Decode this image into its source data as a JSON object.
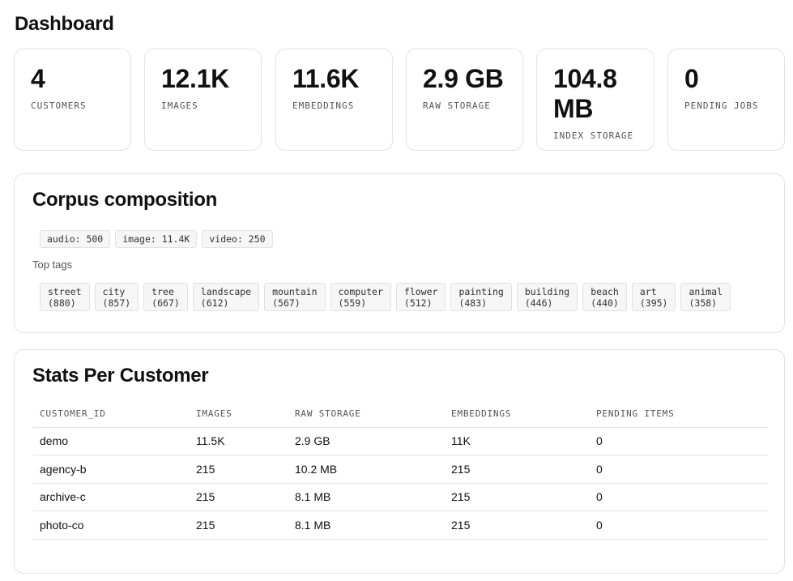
{
  "header": {
    "title": "Dashboard"
  },
  "stats": [
    {
      "value": "4",
      "label": "CUSTOMERS"
    },
    {
      "value": "12.1K",
      "label": "IMAGES"
    },
    {
      "value": "11.6K",
      "label": "EMBEDDINGS"
    },
    {
      "value": "2.9 GB",
      "label": "RAW STORAGE"
    },
    {
      "value": "104.8 MB",
      "label": "INDEX STORAGE"
    },
    {
      "value": "0",
      "label": "PENDING JOBS"
    }
  ],
  "corpus": {
    "title": "Corpus composition",
    "kinds": [
      "audio: 500",
      "image: 11.4K",
      "video: 250"
    ],
    "top_tags_label": "Top tags",
    "tags": [
      {
        "name": "street",
        "count": "(880)"
      },
      {
        "name": "city",
        "count": "(857)"
      },
      {
        "name": "tree",
        "count": "(667)"
      },
      {
        "name": "landscape",
        "count": "(612)"
      },
      {
        "name": "mountain",
        "count": "(567)"
      },
      {
        "name": "computer",
        "count": "(559)"
      },
      {
        "name": "flower",
        "count": "(512)"
      },
      {
        "name": "painting",
        "count": "(483)"
      },
      {
        "name": "building",
        "count": "(446)"
      },
      {
        "name": "beach",
        "count": "(440)"
      },
      {
        "name": "art",
        "count": "(395)"
      },
      {
        "name": "animal",
        "count": "(358)"
      }
    ]
  },
  "customers": {
    "title": "Stats Per Customer",
    "columns": [
      "CUSTOMER_ID",
      "IMAGES",
      "RAW STORAGE",
      "EMBEDDINGS",
      "PENDING ITEMS"
    ],
    "rows": [
      [
        "demo",
        "11.5K",
        "2.9 GB",
        "11K",
        "0"
      ],
      [
        "agency-b",
        "215",
        "10.2 MB",
        "215",
        "0"
      ],
      [
        "archive-c",
        "215",
        "8.1 MB",
        "215",
        "0"
      ],
      [
        "photo-co",
        "215",
        "8.1 MB",
        "215",
        "0"
      ]
    ]
  }
}
